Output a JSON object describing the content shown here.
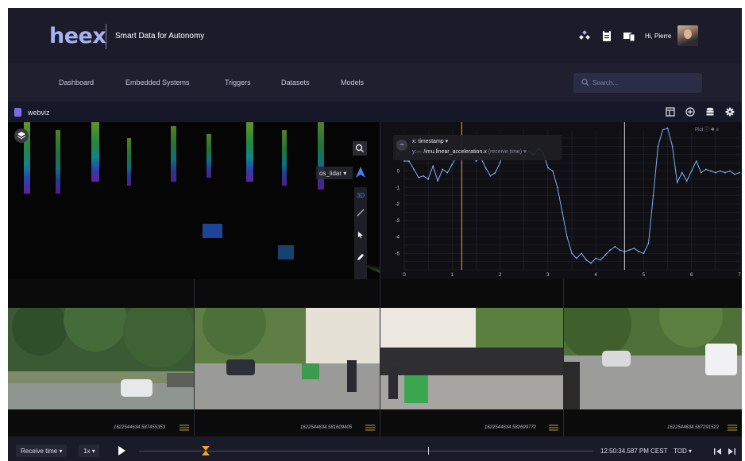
{
  "header": {
    "logo": "heex",
    "tagline": "Smart Data for Autonomy",
    "greeting": "Hi, Pierre",
    "icons": [
      "drone-icon",
      "clipboard-icon",
      "devices-icon"
    ]
  },
  "nav": {
    "items": [
      {
        "label": "Dashboard"
      },
      {
        "label": "Embedded Systems"
      },
      {
        "label": "Triggers"
      },
      {
        "label": "Datasets"
      },
      {
        "label": "Models"
      }
    ],
    "search_placeholder": "Search..."
  },
  "app": {
    "title": "webviz",
    "toolbar_icons": [
      "layout-icon",
      "add-panel-icon",
      "datasource-icon",
      "settings-icon"
    ]
  },
  "lidar": {
    "frame_select": "os_lidar",
    "mode_label": "3D"
  },
  "plot": {
    "menu_label": "Plot",
    "legend_x": "x: timestamp",
    "legend_y_topic": "/imu.linear_acceleration.x",
    "legend_y_suffix": "(receive time)",
    "legend_minimize": "−",
    "chart_data": {
      "type": "line",
      "series": [
        {
          "name": "/imu.linear_acceleration.x",
          "x": [
            0,
            0.1,
            0.2,
            0.3,
            0.4,
            0.5,
            0.6,
            0.7,
            0.8,
            0.9,
            1.0,
            1.1,
            1.2,
            1.3,
            1.4,
            1.5,
            1.6,
            1.7,
            1.8,
            1.9,
            2.0,
            2.1,
            2.2,
            2.3,
            2.4,
            2.5,
            2.6,
            2.7,
            2.8,
            2.9,
            3.0,
            3.1,
            3.2,
            3.3,
            3.4,
            3.5,
            3.6,
            3.7,
            3.8,
            3.9,
            4.0,
            4.1,
            4.2,
            4.3,
            4.4,
            4.5,
            4.6,
            4.7,
            4.8,
            4.9,
            5.0,
            5.1,
            5.2,
            5.3,
            5.4,
            5.5,
            5.6,
            5.7,
            5.8,
            5.9,
            6.0,
            6.1,
            6.2,
            6.3,
            6.4,
            6.5,
            6.6,
            6.7,
            6.8,
            6.9,
            7.0
          ],
          "y": [
            0.6,
            0.6,
            0.1,
            -0.4,
            -0.3,
            -0.5,
            0.3,
            -0.6,
            0.1,
            -0.1,
            0.4,
            0.9,
            1.0,
            0.8,
            1.1,
            0.6,
            0.8,
            0.2,
            -0.3,
            -0.1,
            0.5,
            1.3,
            1.0,
            1.2,
            1.1,
            0.8,
            1.2,
            1.0,
            1.4,
            1.1,
            0.2,
            0.0,
            -1.0,
            -2.5,
            -4.0,
            -5.0,
            -5.3,
            -5.0,
            -5.4,
            -5.6,
            -5.3,
            -5.4,
            -5.1,
            -4.8,
            -4.6,
            -4.8,
            -4.9,
            -4.8,
            -4.7,
            -4.9,
            -5.0,
            -4.4,
            -1.5,
            1.5,
            2.5,
            2.6,
            1.5,
            -0.7,
            -0.1,
            -0.6,
            0.0,
            0.6,
            -0.1,
            0.1,
            0.0,
            -0.1,
            0.0,
            -0.1,
            0.0,
            -0.2,
            -0.1
          ]
        }
      ],
      "xlim": [
        0,
        7
      ],
      "ylim": [
        -6,
        2
      ],
      "x_ticks": [
        "0",
        "1",
        "2",
        "3",
        "4",
        "5",
        "6",
        "7"
      ],
      "y_ticks": [
        "1",
        "0",
        "-1",
        "-2",
        "-3",
        "-4",
        "-5"
      ],
      "cursor_x": 1.2,
      "playhead_x": 4.6,
      "grid": true,
      "line_color": "#7eb0f5",
      "cursor_color": "#f5a623"
    }
  },
  "cameras": [
    {
      "timestamp": "1622544634.587455353"
    },
    {
      "timestamp": "1622544634.581609405"
    },
    {
      "timestamp": "1622544634.582699772"
    },
    {
      "timestamp": "1622544634.587291522"
    }
  ],
  "footer": {
    "time_mode": "Receive time",
    "speed": "1x",
    "playback_fraction": 0.147,
    "end_marker_fraction": 0.636,
    "current_time": "12:50:34.587 PM CEST",
    "timezone": "TOD"
  },
  "colors": {
    "accent": "#a8b2f2",
    "cursor": "#f5a623",
    "line": "#7eb0f5",
    "bg": "#15151f"
  }
}
